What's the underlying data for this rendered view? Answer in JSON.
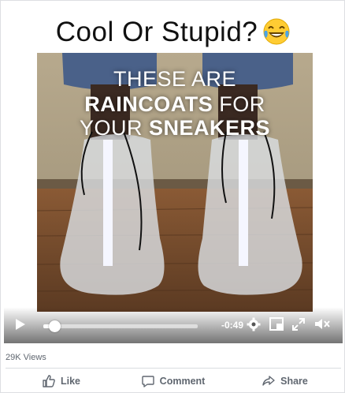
{
  "video": {
    "caption_title": "Cool Or Stupid?",
    "emoji": "laughing-tears-emoji",
    "overlay": {
      "line1": "THESE ARE",
      "line2_bold": "RAINCOATS",
      "line2_rest": " FOR",
      "line3_rest": "YOUR ",
      "line3_bold": "SNEAKERS"
    },
    "time_remaining": "-0:49",
    "progress": 0.07
  },
  "stats": {
    "views": "29K Views"
  },
  "actions": {
    "like": "Like",
    "comment": "Comment",
    "share": "Share"
  },
  "colors": {
    "text_secondary": "#606770",
    "divider": "#dadde1"
  }
}
